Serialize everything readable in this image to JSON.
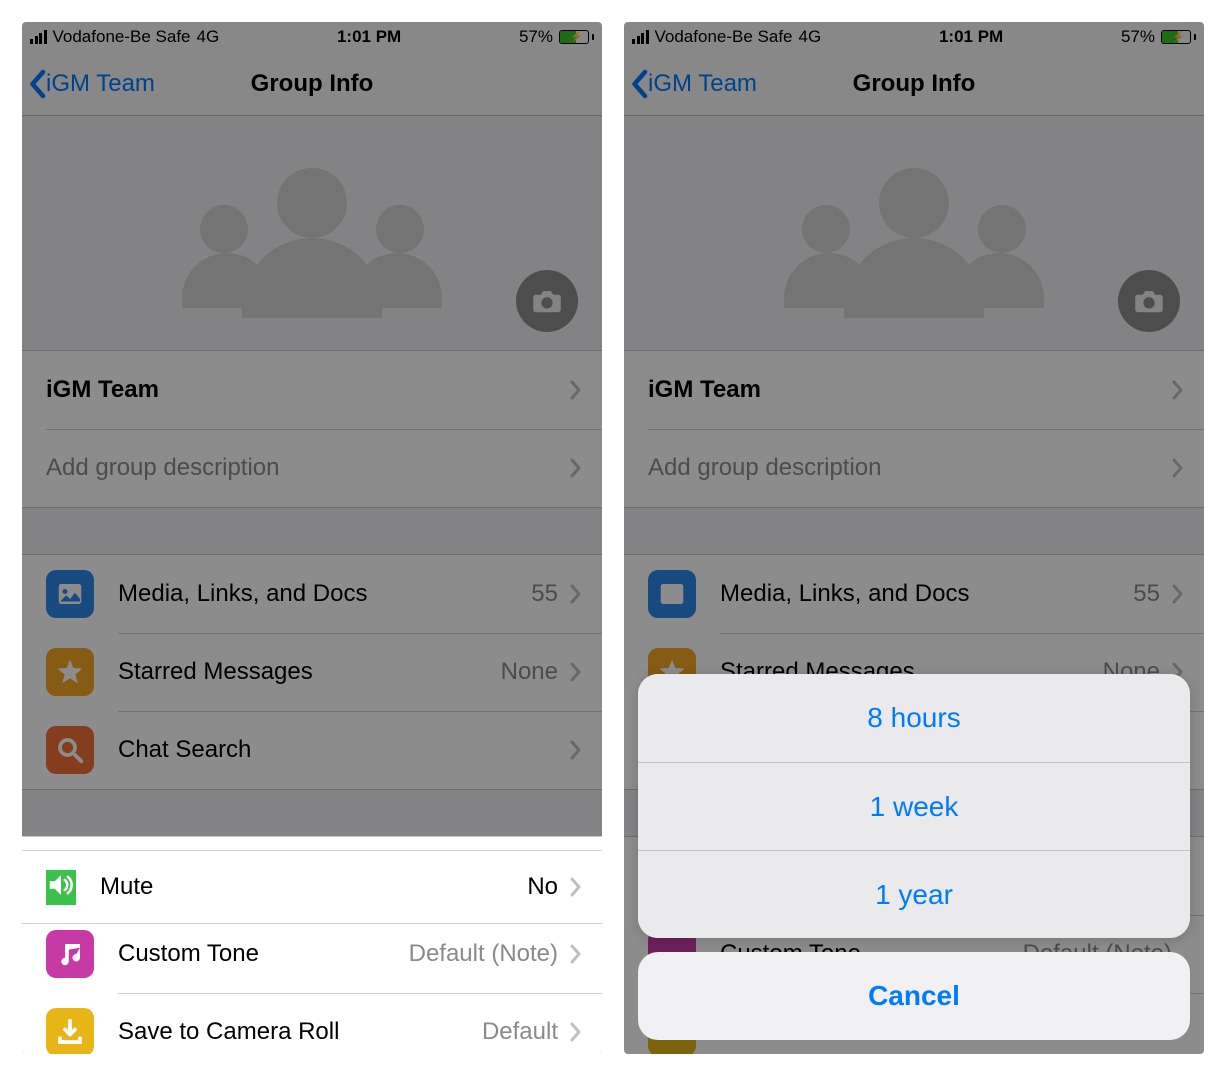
{
  "status": {
    "carrier": "Vodafone-Be Safe",
    "network": "4G",
    "time": "1:01 PM",
    "battery_pct": "57%"
  },
  "nav": {
    "back_label": "iGM Team",
    "title": "Group Info"
  },
  "group": {
    "name": "iGM Team",
    "desc_placeholder": "Add group description"
  },
  "rows": {
    "media": {
      "label": "Media, Links, and Docs",
      "value": "55"
    },
    "starred": {
      "label": "Starred Messages",
      "value": "None"
    },
    "search": {
      "label": "Chat Search"
    },
    "mute": {
      "label": "Mute",
      "value": "No"
    },
    "tone": {
      "label": "Custom Tone",
      "value": "Default (Note)"
    },
    "save": {
      "label": "Save to Camera Roll",
      "value": "Default"
    }
  },
  "sheet": {
    "opt1": "8 hours",
    "opt2": "1 week",
    "opt3": "1 year",
    "cancel": "Cancel"
  }
}
